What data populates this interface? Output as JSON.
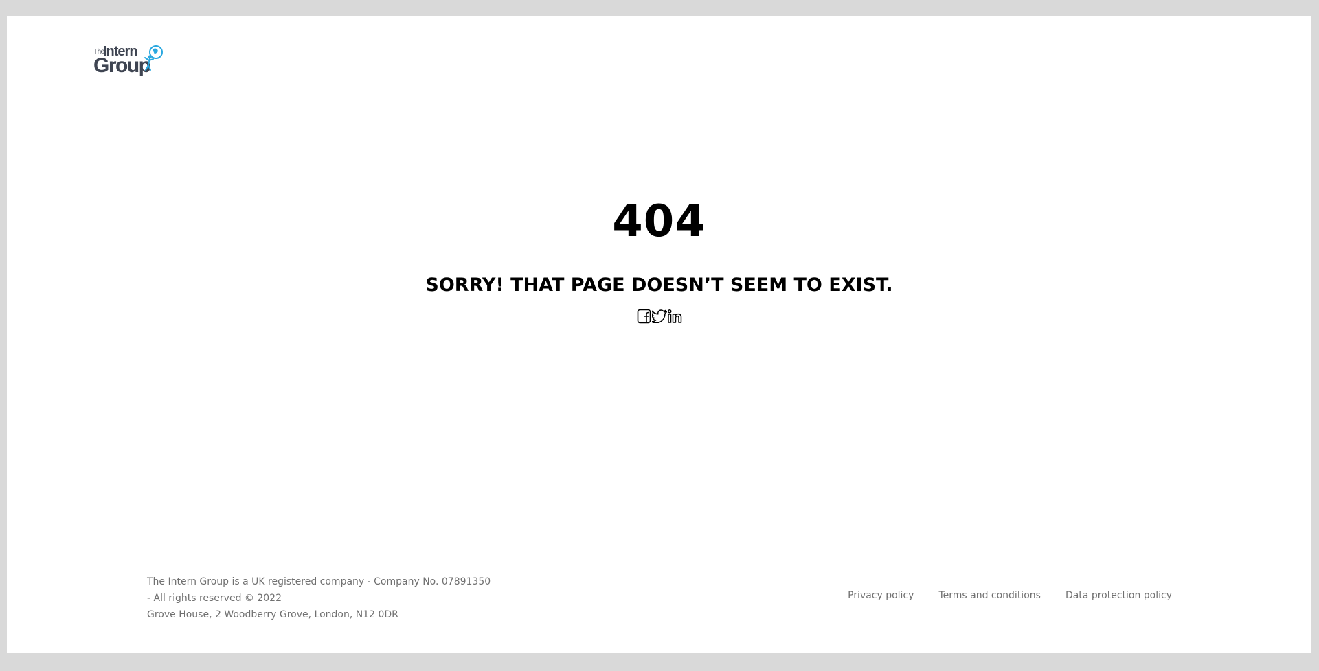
{
  "logo": {
    "the": "The",
    "intern": "Intern",
    "group": "Group",
    "colors": {
      "text": "#3f4552",
      "accent": "#2aa8e0"
    }
  },
  "error": {
    "code": "404",
    "message": "SORRY! THAT PAGE DOESN’T SEEM TO EXIST."
  },
  "socials": [
    {
      "icon": "facebook-icon"
    },
    {
      "icon": "twitter-icon"
    },
    {
      "icon": "linkedin-icon"
    }
  ],
  "footer": {
    "line1": "The Intern Group is a UK registered company - Company No. 07891350",
    "line2": "- All rights reserved © 2022",
    "line3": "Grove House, 2 Woodberry Grove, London, N12 0DR",
    "links": {
      "privacy": "Privacy policy",
      "terms": "Terms and conditions",
      "data_protection": "Data protection policy"
    }
  }
}
